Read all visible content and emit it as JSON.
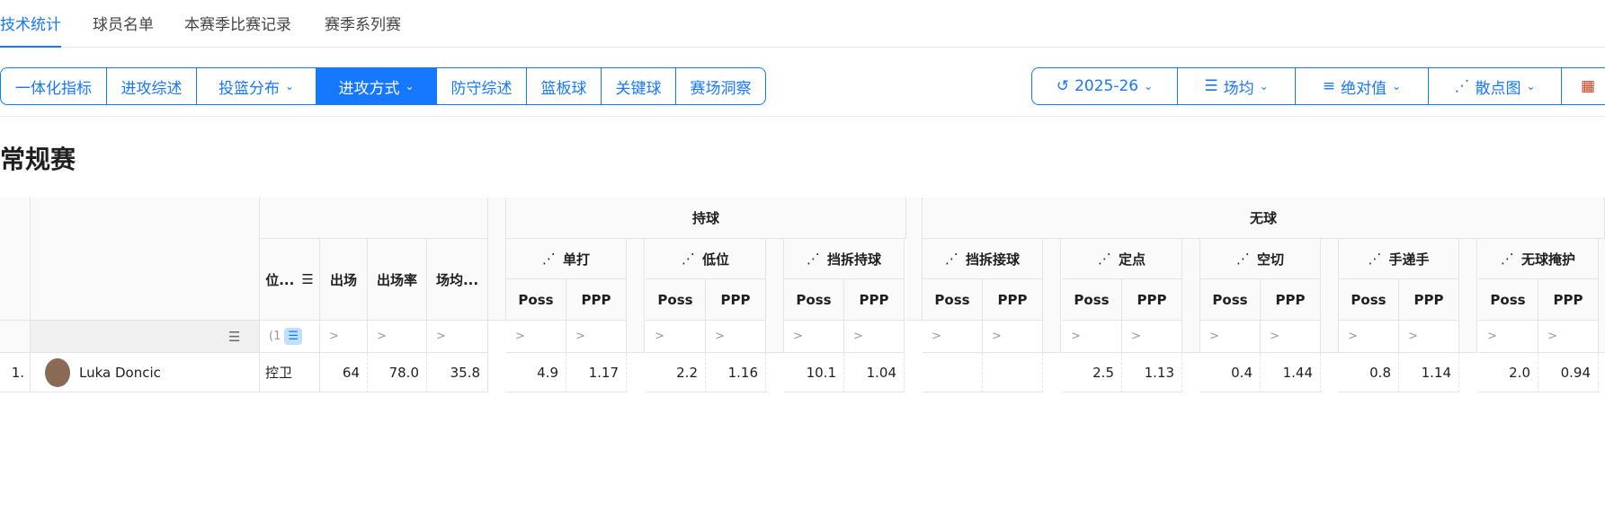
{
  "tabs": [
    "技术统计",
    "球员名单",
    "本赛季比赛记录",
    "赛季系列赛"
  ],
  "segments": [
    "一体化指标",
    "进攻综述",
    "投篮分布",
    "进攻方式",
    "防守综述",
    "篮板球",
    "关键球",
    "赛场洞察"
  ],
  "right_controls": [
    "2025-26",
    "场均",
    "绝对值",
    "散点图"
  ],
  "section_title": "常规赛",
  "headers": {
    "pos": "位...",
    "games": "出场",
    "rate": "出场率",
    "mpg": "场均...",
    "group1": "持球",
    "group2": "无球",
    "play_types": [
      "单打",
      "低位",
      "挡拆持球",
      "挡拆接球",
      "定点",
      "空切",
      "手递手",
      "无球掩护"
    ],
    "poss": "Poss",
    "ppp": "PPP",
    "filter_hint": ">",
    "pos_filter_text": "(1"
  },
  "row": {
    "rank": "1.",
    "name": "Luka Doncic",
    "pos": "控卫",
    "games": "64",
    "rate": "78.0",
    "mpg": "35.8",
    "stats": [
      "4.9",
      "1.17",
      "2.2",
      "1.16",
      "10.1",
      "1.04",
      "",
      "",
      "2.5",
      "1.13",
      "0.4",
      "1.44",
      "0.8",
      "1.14",
      "2.0",
      "0.94"
    ]
  },
  "colors": {
    "accent": "#1677ff",
    "border": "#e4e4e4"
  }
}
